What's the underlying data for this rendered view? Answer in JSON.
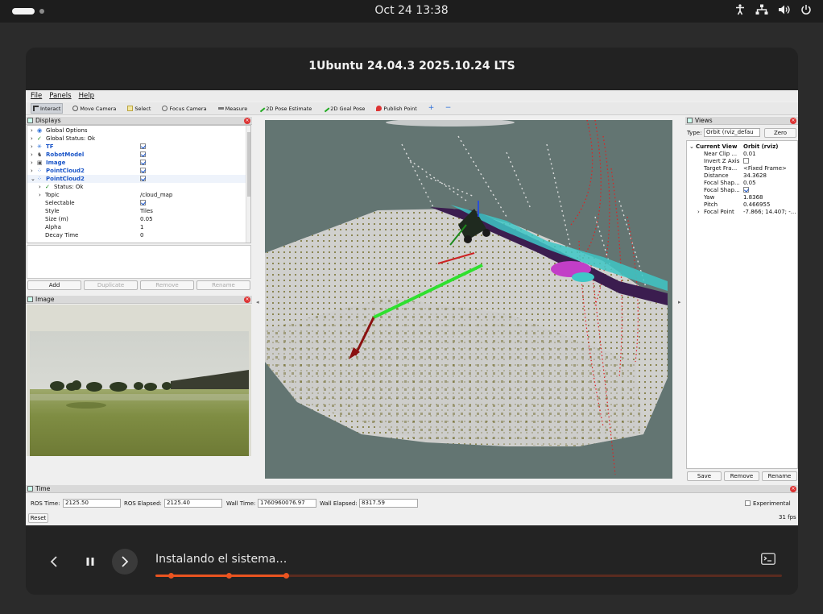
{
  "topbar": {
    "clock": "Oct 24  13:38"
  },
  "window": {
    "title": "1Ubuntu 24.04.3 2025.10.24 LTS"
  },
  "rviz": {
    "menu": [
      "File",
      "Panels",
      "Help"
    ],
    "tools": [
      "Interact",
      "Move Camera",
      "Select",
      "Focus Camera",
      "Measure",
      "2D Pose Estimate",
      "2D Goal Pose",
      "Publish Point"
    ],
    "displays": {
      "title": "Displays",
      "rows": [
        {
          "label": "Global Options",
          "value": ""
        },
        {
          "label": "Global Status: Ok",
          "value": ""
        },
        {
          "label": "TF",
          "value": ""
        },
        {
          "label": "RobotModel",
          "value": ""
        },
        {
          "label": "Image",
          "value": ""
        },
        {
          "label": "PointCloud2",
          "value": ""
        },
        {
          "label": "PointCloud2",
          "value": ""
        },
        {
          "label": "Status: Ok",
          "value": ""
        },
        {
          "label": "Topic",
          "value": "/cloud_map"
        },
        {
          "label": "Selectable",
          "value": ""
        },
        {
          "label": "Style",
          "value": "Tiles"
        },
        {
          "label": "Size (m)",
          "value": "0.05"
        },
        {
          "label": "Alpha",
          "value": "1"
        },
        {
          "label": "Decay Time",
          "value": "0"
        }
      ],
      "buttons": {
        "add": "Add",
        "duplicate": "Duplicate",
        "remove": "Remove",
        "rename": "Rename"
      }
    },
    "image_panel": {
      "title": "Image"
    },
    "views": {
      "title": "Views",
      "type_label": "Type:",
      "type_value": "Orbit (rviz_defau",
      "zero": "Zero",
      "rows": [
        {
          "label": "Current View",
          "value": "Orbit (rviz)"
        },
        {
          "label": "Near Clip ...",
          "value": "0.01"
        },
        {
          "label": "Invert Z Axis",
          "value": ""
        },
        {
          "label": "Target Fra...",
          "value": "<Fixed Frame>"
        },
        {
          "label": "Distance",
          "value": "34.3628"
        },
        {
          "label": "Focal Shap...",
          "value": "0.05"
        },
        {
          "label": "Focal Shap...",
          "value": ""
        },
        {
          "label": "Yaw",
          "value": "1.8368"
        },
        {
          "label": "Pitch",
          "value": "0.466955"
        },
        {
          "label": "Focal Point",
          "value": "-7.866; 14.407; -..."
        }
      ],
      "buttons": {
        "save": "Save",
        "remove": "Remove",
        "rename": "Rename"
      }
    },
    "time": {
      "title": "Time",
      "ros_time_label": "ROS Time:",
      "ros_time": "2125.50",
      "ros_elapsed_label": "ROS Elapsed:",
      "ros_elapsed": "2125.40",
      "wall_time_label": "Wall Time:",
      "wall_time": "1760960076.97",
      "wall_elapsed_label": "Wall Elapsed:",
      "wall_elapsed": "8317.59",
      "experimental": "Experimental",
      "reset": "Reset",
      "fps": "31 fps"
    }
  },
  "installer": {
    "status": "Instalando el sistema…",
    "progress": 0.21
  },
  "colors": {
    "accent": "#e95420",
    "viewport_bg": "#637572"
  }
}
